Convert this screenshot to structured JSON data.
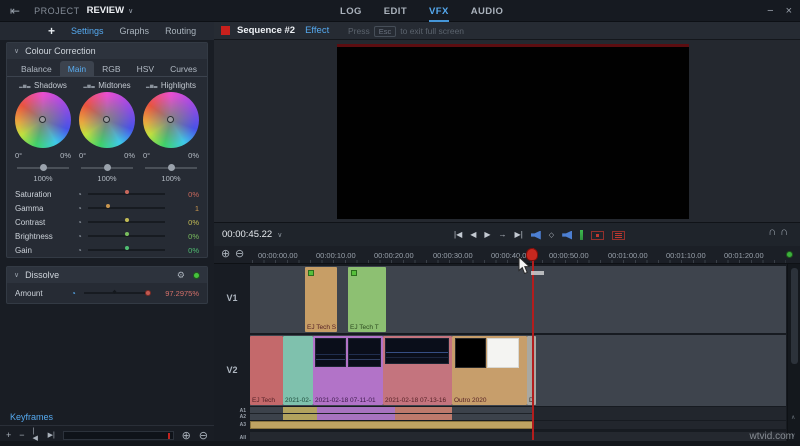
{
  "topbar": {
    "project_label": "PROJECT",
    "project_name": "REVIEW",
    "tabs": [
      "LOG",
      "EDIT",
      "VFX",
      "AUDIO"
    ],
    "active_tab": "VFX"
  },
  "window": {
    "minimize": "−",
    "close": "×"
  },
  "icons": {
    "back": "⇤",
    "chevron_down": "∨",
    "plus": "+",
    "minus": "−",
    "histogram": "▂▅▃",
    "clock": "◔",
    "gear": "⚙",
    "skip_start": "|◀",
    "step_back": "◀",
    "play": "▶",
    "step_forward": "→",
    "skip_end": "▶|",
    "diamond": "◇",
    "headphone": "∩∩",
    "zoom_in": "⊕",
    "zoom_out": "⊖",
    "keyframe_marker": "◆"
  },
  "left_panel": {
    "tabs": [
      "Settings",
      "Graphs",
      "Routing"
    ],
    "active_tab": "Settings",
    "colour_correction": {
      "title": "Colour Correction",
      "tabs": [
        "Balance",
        "Main",
        "RGB",
        "HSV",
        "Curves"
      ],
      "active_tab": "Main",
      "columns": [
        {
          "label": "Shadows",
          "degrees": "0°",
          "percent": "0%",
          "amount": "100%"
        },
        {
          "label": "Midtones",
          "degrees": "0°",
          "percent": "0%",
          "amount": "100%"
        },
        {
          "label": "Highlights",
          "degrees": "0°",
          "percent": "0%",
          "amount": "100%"
        }
      ],
      "sliders": [
        {
          "label": "Saturation",
          "value": "0%",
          "color": "#c9685c"
        },
        {
          "label": "Gamma",
          "value": "1",
          "color": "#c9964f"
        },
        {
          "label": "Contrast",
          "value": "0%",
          "color": "#c2bb55"
        },
        {
          "label": "Brightness",
          "value": "0%",
          "color": "#79bd5d"
        },
        {
          "label": "Gain",
          "value": "0%",
          "color": "#4fbd71"
        }
      ]
    },
    "dissolve": {
      "title": "Dissolve",
      "amount_label": "Amount",
      "value": "97.2975%"
    },
    "keyframes": {
      "title": "Keyframes"
    }
  },
  "viewer": {
    "title": "Sequence #2",
    "effect_tab": "Effect",
    "hint_pre": "Press",
    "hint_key": "Esc",
    "hint_post": "to exit full screen",
    "timecode": "00:00:45.22"
  },
  "timeline": {
    "ruler": [
      "00:00:00.00",
      "00:00:10.00",
      "00:00:20.00",
      "00:00:30.00",
      "00:00:40.00",
      "00:00:50.00",
      "00:01:00.00",
      "00:01:10.00",
      "00:01:20.00"
    ],
    "tracks": {
      "v1": "V1",
      "v2": "V2",
      "a1": "A1",
      "a2": "A2",
      "a3": "A3",
      "all": "All"
    },
    "v1_clips": [
      {
        "label": "EJ Tech S"
      },
      {
        "label": "EJ Tech T"
      }
    ],
    "v2_clips": [
      {
        "label": "EJ Tech"
      },
      {
        "label": "2021-02-"
      },
      {
        "label": "2021-02-18 07-11-01"
      },
      {
        "label": "2021-02-18 07-13-16"
      },
      {
        "label": "Outro 2020"
      },
      {
        "label": "D"
      }
    ],
    "playhead_color": "#c2231f"
  },
  "colors": {
    "accent_blue": "#55a9ef",
    "panel_bg": "#191d24",
    "track_bg": "#3e444d",
    "clip_tan": "#c79e66",
    "clip_green": "#8dc072",
    "clip_salmon": "#c4696b",
    "clip_teal": "#7fc1ad",
    "clip_violet": "#b273c8",
    "clip_pink": "#c4747e"
  },
  "watermark": "wtvid.com"
}
